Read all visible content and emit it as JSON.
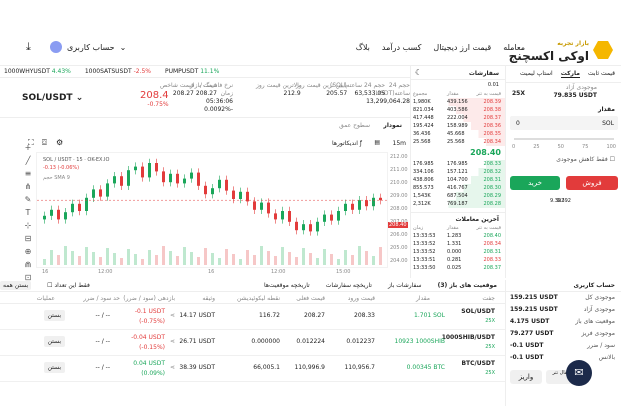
{
  "nav": {
    "logo": "اوکی اکسچنج",
    "logo_sub": "بازار تجربه",
    "items": [
      "معامله",
      "قیمت ارز دیجیتال",
      "کسب درآمد",
      "بلاگ"
    ],
    "account": "حساب کاربری"
  },
  "ticker": [
    {
      "sym": "1000WHYUSDT",
      "chg": "4.43%",
      "c": "g"
    },
    {
      "sym": "1000SATSUSDT",
      "chg": "-2.5%",
      "c": "r"
    },
    {
      "sym": "PUMPUSDT",
      "chg": "11.1%",
      "c": "g"
    }
  ],
  "pair": {
    "name": "SOL/USDT",
    "price": "208.4",
    "pct": "-0.75%",
    "stats": [
      [
        "قیمت بازار",
        "208.27"
      ],
      [
        "قیمت شاخص",
        "208.27"
      ],
      [
        "نرخ فاندینگ / زمان",
        "05:36:06",
        "-0.0092%"
      ],
      [
        "بالاترین قیمت روز",
        "212.9"
      ],
      [
        "پایین ترین قیمت روز",
        "205.57"
      ],
      [
        "حجم 24 ساعته(SOL)",
        "63,533.05"
      ],
      [
        "حجم 24 ساعته(USDT)",
        "13,299,064.28"
      ]
    ]
  },
  "chart_tools": {
    "tabs": [
      "نمودار",
      "سطوح عمق"
    ],
    "interval": "15m",
    "indicators": "اندیکاتورها",
    "pair_label": "SOL / USDT · 15 · OK-EX.IO",
    "change": "-0.13 (-0.06%)",
    "volume": "حجم SMA 9",
    "yticks": [
      "212.00",
      "211.00",
      "210.00",
      "209.00",
      "208.00",
      "207.00",
      "206.00",
      "205.00",
      "204.00"
    ],
    "xticks": [
      "16",
      "12:00",
      "16",
      "12:00",
      "15:00"
    ],
    "mark": "208.40",
    "time": "16:00"
  },
  "book": {
    "title": "سفارشات",
    "trades_title": "تاریخچه",
    "step": "0.01",
    "headers": [
      "قیمت به تتر",
      "مقدار",
      "مجموع"
    ],
    "asks": [
      [
        "208.39",
        "439.156",
        "1,980K"
      ],
      [
        "208.38",
        "403.586",
        "821.034"
      ],
      [
        "208.37",
        "222.004",
        "417.448"
      ],
      [
        "208.36",
        "158.989",
        "195.424"
      ],
      [
        "208.35",
        "45.668",
        "36.436"
      ],
      [
        "208.34",
        "25.568",
        "25.568"
      ]
    ],
    "mid": "208.40",
    "bids": [
      [
        "208.33",
        "176.985",
        "176.985"
      ],
      [
        "208.32",
        "157.121",
        "334.106"
      ],
      [
        "208.31",
        "104.700",
        "438.806"
      ],
      [
        "208.30",
        "416.767",
        "855.573"
      ],
      [
        "208.29",
        "687.504",
        "1,543K"
      ],
      [
        "208.28",
        "769.187",
        "2,312K"
      ]
    ],
    "recent_title": "آخرین معاملات",
    "recent_headers": [
      "قیمت به تتر",
      "مقدار",
      "زمان"
    ],
    "recent": [
      [
        "208.40",
        "1.283",
        "13:33:53"
      ],
      [
        "208.34",
        "1.331",
        "13:33:52"
      ],
      [
        "208.31",
        "0.000",
        "13:33:52"
      ],
      [
        "208.33",
        "0.281",
        "13:33:51"
      ],
      [
        "208.37",
        "0.025",
        "13:33:50"
      ]
    ]
  },
  "order": {
    "tabs": [
      "قیمت ثابت",
      "مارکت",
      "استاپ لیمیت"
    ],
    "avail_label": "موجودی آزاد",
    "avail": "79.835 USDT",
    "lev": "25X",
    "amount_label": "مقدار",
    "amount_unit": "SOL",
    "slider": [
      "0",
      "25",
      "50",
      "75",
      "100"
    ],
    "tpsl": "فقط کاهش موجودی",
    "buy": "خرید",
    "sell": "فروش",
    "max_buy": "9.392",
    "max_sell": "9.392"
  },
  "bottom": {
    "tabs": [
      "موقعیت های باز (3)",
      "سفارشات باز",
      "تاریخچه سفارشات",
      "تاریخچه موقعیت‌ها"
    ],
    "hide": "فقط این تعداد",
    "close_all": "بستن همه",
    "headers": [
      "جفت",
      "مقدار",
      "قیمت ورود",
      "قیمت فعلی",
      "نقطه لیکوئیدیشن",
      "وثیقه",
      "بازدهی (سود / ضرر)",
      "حد سود / ضرر",
      "عملیات"
    ],
    "rows": [
      {
        "pair": "SOL/USDT",
        "sub": "25X",
        "size": "1.701 SOL",
        "entry": "208.33",
        "mark": "208.27",
        "liq": "116.72",
        "margin": "14.17 USDT",
        "pnl": "-0.1 USDT",
        "pnl2": "(-0.75%)",
        "c": "r",
        "tp": "-- / --",
        "act": "بستن"
      },
      {
        "pair": "1000SHIB/USDT",
        "sub": "25X",
        "size": "10923 1000SHIB",
        "entry": "0.012237",
        "mark": "0.012224",
        "liq": "0.000000",
        "margin": "26.71 USDT",
        "pnl": "-0.04 USDT",
        "pnl2": "(-0.15%)",
        "c": "r",
        "tp": "-- / --",
        "act": "بستن"
      },
      {
        "pair": "BTC/USDT",
        "sub": "25X",
        "size": "0.00345 BTC",
        "entry": "110,956.7",
        "mark": "110,996.9",
        "liq": "66,005.1",
        "margin": "38.39 USDT",
        "pnl": "0.04 USDT",
        "pnl2": "(0.09%)",
        "c": "g",
        "tp": "-- / --",
        "act": "بستن"
      }
    ]
  },
  "account": {
    "title": "حساب کاربری",
    "rows": [
      [
        "موجودی کل",
        "159.215 USDT"
      ],
      [
        "موجودی آزاد",
        "159.215 USDT"
      ],
      [
        "موقعیت های باز",
        "4.175 USDT"
      ],
      [
        "موجودی فریز",
        "79.277 USDT"
      ],
      [
        "سود / ضرر",
        "-0.1 USDT"
      ],
      [
        "بالانس",
        "-0.1 USDT"
      ]
    ],
    "deposit": "واریز",
    "transfer": "انتقال تتر",
    "withdraw": "برداشت"
  },
  "chart_data": {
    "type": "candlestick",
    "ylim": [
      204,
      212
    ],
    "series": [
      207.1,
      207.6,
      206.8,
      207.4,
      208.1,
      207.5,
      208.6,
      209.3,
      208.7,
      209.8,
      210.4,
      209.6,
      210.9,
      211.2,
      210.3,
      211.5,
      210.8,
      209.9,
      210.6,
      209.8,
      210.2,
      210.7,
      209.6,
      208.9,
      209.4,
      210.1,
      209.2,
      208.5,
      209.1,
      208.3,
      207.6,
      208.2,
      207.3,
      206.8,
      207.5,
      206.6,
      205.9,
      206.4,
      205.8,
      206.6,
      207.2,
      206.7,
      207.5,
      208.1,
      207.6,
      208.4,
      207.9,
      208.6,
      208.4
    ]
  }
}
